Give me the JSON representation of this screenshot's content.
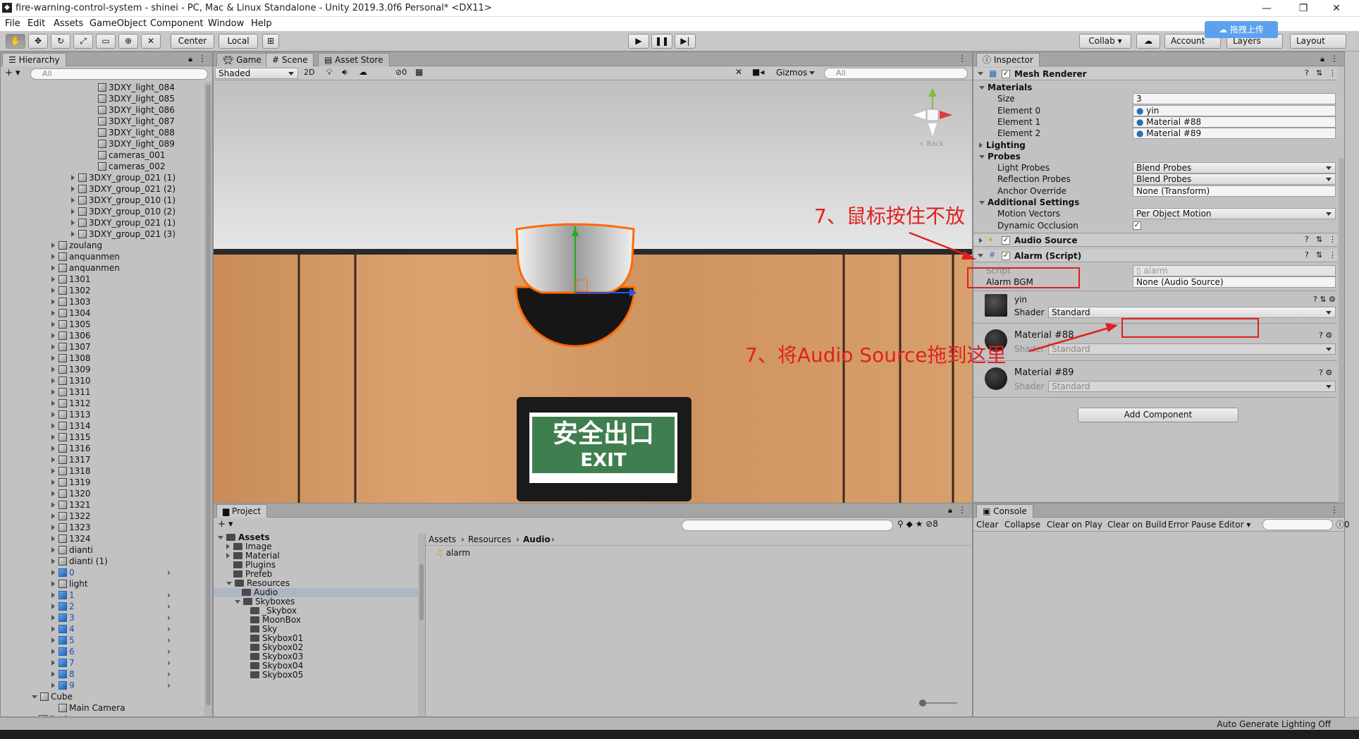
{
  "window": {
    "title": "fire-warning-control-system - shinei - PC, Mac & Linux Standalone - Unity 2019.3.0f6 Personal* <DX11>",
    "min": "—",
    "max": "❐",
    "close": "✕"
  },
  "menu": [
    "File",
    "Edit",
    "Assets",
    "GameObject",
    "Component",
    "Window",
    "Help"
  ],
  "toolbar": {
    "center": "Center",
    "local": "Local",
    "collab": "Collab ▾",
    "account": "Account",
    "layers": "Layers",
    "layout": "Layout",
    "upload": "拖拽上传"
  },
  "hierarchy": {
    "tab": "Hierarchy",
    "search_placeholder": "All",
    "items": [
      {
        "label": "3DXY_light_084",
        "indent": 3,
        "arrow": "none",
        "blue": false
      },
      {
        "label": "3DXY_light_085",
        "indent": 3,
        "arrow": "none",
        "blue": false
      },
      {
        "label": "3DXY_light_086",
        "indent": 3,
        "arrow": "none",
        "blue": false
      },
      {
        "label": "3DXY_light_087",
        "indent": 3,
        "arrow": "none",
        "blue": false
      },
      {
        "label": "3DXY_light_088",
        "indent": 3,
        "arrow": "none",
        "blue": false
      },
      {
        "label": "3DXY_light_089",
        "indent": 3,
        "arrow": "none",
        "blue": false
      },
      {
        "label": "cameras_001",
        "indent": 3,
        "arrow": "none",
        "blue": false
      },
      {
        "label": "cameras_002",
        "indent": 3,
        "arrow": "none",
        "blue": false
      },
      {
        "label": "3DXY_group_021 (1)",
        "indent": 2,
        "arrow": "right",
        "blue": false
      },
      {
        "label": "3DXY_group_021 (2)",
        "indent": 2,
        "arrow": "right",
        "blue": false
      },
      {
        "label": "3DXY_group_010 (1)",
        "indent": 2,
        "arrow": "right",
        "blue": false
      },
      {
        "label": "3DXY_group_010 (2)",
        "indent": 2,
        "arrow": "right",
        "blue": false
      },
      {
        "label": "3DXY_group_021 (1)",
        "indent": 2,
        "arrow": "right",
        "blue": false
      },
      {
        "label": "3DXY_group_021 (3)",
        "indent": 2,
        "arrow": "right",
        "blue": false
      },
      {
        "label": "zoulang",
        "indent": 1,
        "arrow": "right",
        "blue": false
      },
      {
        "label": "anquanmen",
        "indent": 1,
        "arrow": "right",
        "blue": false
      },
      {
        "label": "anquanmen",
        "indent": 1,
        "arrow": "right",
        "blue": false
      },
      {
        "label": "1301",
        "indent": 1,
        "arrow": "right",
        "blue": false
      },
      {
        "label": "1302",
        "indent": 1,
        "arrow": "right",
        "blue": false
      },
      {
        "label": "1303",
        "indent": 1,
        "arrow": "right",
        "blue": false
      },
      {
        "label": "1304",
        "indent": 1,
        "arrow": "right",
        "blue": false
      },
      {
        "label": "1305",
        "indent": 1,
        "arrow": "right",
        "blue": false
      },
      {
        "label": "1306",
        "indent": 1,
        "arrow": "right",
        "blue": false
      },
      {
        "label": "1307",
        "indent": 1,
        "arrow": "right",
        "blue": false
      },
      {
        "label": "1308",
        "indent": 1,
        "arrow": "right",
        "blue": false
      },
      {
        "label": "1309",
        "indent": 1,
        "arrow": "right",
        "blue": false
      },
      {
        "label": "1310",
        "indent": 1,
        "arrow": "right",
        "blue": false
      },
      {
        "label": "1311",
        "indent": 1,
        "arrow": "right",
        "blue": false
      },
      {
        "label": "1312",
        "indent": 1,
        "arrow": "right",
        "blue": false
      },
      {
        "label": "1313",
        "indent": 1,
        "arrow": "right",
        "blue": false
      },
      {
        "label": "1314",
        "indent": 1,
        "arrow": "right",
        "blue": false
      },
      {
        "label": "1315",
        "indent": 1,
        "arrow": "right",
        "blue": false
      },
      {
        "label": "1316",
        "indent": 1,
        "arrow": "right",
        "blue": false
      },
      {
        "label": "1317",
        "indent": 1,
        "arrow": "right",
        "blue": false
      },
      {
        "label": "1318",
        "indent": 1,
        "arrow": "right",
        "blue": false
      },
      {
        "label": "1319",
        "indent": 1,
        "arrow": "right",
        "blue": false
      },
      {
        "label": "1320",
        "indent": 1,
        "arrow": "right",
        "blue": false
      },
      {
        "label": "1321",
        "indent": 1,
        "arrow": "right",
        "blue": false
      },
      {
        "label": "1322",
        "indent": 1,
        "arrow": "right",
        "blue": false
      },
      {
        "label": "1323",
        "indent": 1,
        "arrow": "right",
        "blue": false
      },
      {
        "label": "1324",
        "indent": 1,
        "arrow": "right",
        "blue": false
      },
      {
        "label": "dianti",
        "indent": 1,
        "arrow": "right",
        "blue": false
      },
      {
        "label": "dianti (1)",
        "indent": 1,
        "arrow": "right",
        "blue": false
      },
      {
        "label": "0",
        "indent": 1,
        "arrow": "right",
        "blue": true
      },
      {
        "label": "light",
        "indent": 1,
        "arrow": "right",
        "blue": false
      },
      {
        "label": "1",
        "indent": 1,
        "arrow": "right",
        "blue": true
      },
      {
        "label": "2",
        "indent": 1,
        "arrow": "right",
        "blue": true
      },
      {
        "label": "3",
        "indent": 1,
        "arrow": "right",
        "blue": true
      },
      {
        "label": "4",
        "indent": 1,
        "arrow": "right",
        "blue": true
      },
      {
        "label": "5",
        "indent": 1,
        "arrow": "right",
        "blue": true
      },
      {
        "label": "6",
        "indent": 1,
        "arrow": "right",
        "blue": true
      },
      {
        "label": "7",
        "indent": 1,
        "arrow": "right",
        "blue": true
      },
      {
        "label": "8",
        "indent": 1,
        "arrow": "right",
        "blue": true
      },
      {
        "label": "9",
        "indent": 1,
        "arrow": "right",
        "blue": true
      },
      {
        "label": "Cube",
        "indent": 0,
        "arrow": "down",
        "blue": false
      },
      {
        "label": "Main Camera",
        "indent": 1,
        "arrow": "none",
        "blue": false
      },
      {
        "label": "jiankong",
        "indent": 0,
        "arrow": "none",
        "blue": false
      }
    ]
  },
  "scene": {
    "tabs": [
      "Game",
      "Scene",
      "Asset Store"
    ],
    "shading": "Shaded",
    "mode2d": "2D",
    "fx_count": "0",
    "gizmos": "Gizmos",
    "search_placeholder": "All",
    "back_label": "< Back",
    "exit_sign_cn": "安全出口",
    "exit_sign_en": "EXIT"
  },
  "inspector": {
    "tab": "Inspector",
    "mesh_renderer": "Mesh Renderer",
    "materials": "Materials",
    "size_label": "Size",
    "size_value": "3",
    "elements": [
      {
        "label": "Element 0",
        "value": "yin"
      },
      {
        "label": "Element 1",
        "value": "Material #88"
      },
      {
        "label": "Element 2",
        "value": "Material #89"
      }
    ],
    "lighting": "Lighting",
    "probes": "Probes",
    "light_probes_label": "Light Probes",
    "light_probes_value": "Blend Probes",
    "reflection_probes_label": "Reflection Probes",
    "reflection_probes_value": "Blend Probes",
    "anchor_override_label": "Anchor Override",
    "anchor_override_value": "None (Transform)",
    "additional_settings": "Additional Settings",
    "motion_vectors_label": "Motion Vectors",
    "motion_vectors_value": "Per Object Motion",
    "dynamic_occlusion_label": "Dynamic Occlusion",
    "audio_source": "Audio Source",
    "alarm_script": "Alarm (Script)",
    "script_label": "Script",
    "script_value": "alarm",
    "alarm_bgm_label": "Alarm BGM",
    "alarm_bgm_value": "None (Audio Source)",
    "mat_yin": "yin",
    "shader_label": "Shader",
    "shader_value": "Standard",
    "mat_88": "Material #88",
    "mat_89": "Material #89",
    "add_component": "Add Component"
  },
  "annotations": {
    "a1": "7、鼠标按住不放",
    "a2": "7、将Audio Source拖到这里"
  },
  "project": {
    "tab": "Project",
    "favorites_count": "8",
    "tree": [
      {
        "label": "Assets",
        "indent": 0,
        "arrow": "down",
        "bold": true
      },
      {
        "label": "Image",
        "indent": 1,
        "arrow": "right",
        "bold": false
      },
      {
        "label": "Material",
        "indent": 1,
        "arrow": "right",
        "bold": false
      },
      {
        "label": "Plugins",
        "indent": 1,
        "arrow": "none",
        "bold": false
      },
      {
        "label": "Prefeb",
        "indent": 1,
        "arrow": "none",
        "bold": false
      },
      {
        "label": "Resources",
        "indent": 1,
        "arrow": "down",
        "bold": false
      },
      {
        "label": "Audio",
        "indent": 2,
        "arrow": "none",
        "bold": false,
        "selected": true
      },
      {
        "label": "Skyboxes",
        "indent": 2,
        "arrow": "down",
        "bold": false
      },
      {
        "label": "_Skybox",
        "indent": 3,
        "arrow": "none",
        "bold": false
      },
      {
        "label": "MoonBox",
        "indent": 3,
        "arrow": "none",
        "bold": false
      },
      {
        "label": "Sky",
        "indent": 3,
        "arrow": "none",
        "bold": false
      },
      {
        "label": "Skybox01",
        "indent": 3,
        "arrow": "none",
        "bold": false
      },
      {
        "label": "Skybox02",
        "indent": 3,
        "arrow": "none",
        "bold": false
      },
      {
        "label": "Skybox03",
        "indent": 3,
        "arrow": "none",
        "bold": false
      },
      {
        "label": "Skybox04",
        "indent": 3,
        "arrow": "none",
        "bold": false
      },
      {
        "label": "Skybox05",
        "indent": 3,
        "arrow": "none",
        "bold": false
      }
    ],
    "breadcrumb": [
      "Assets",
      "Resources",
      "Audio"
    ],
    "files": [
      "alarm"
    ]
  },
  "console": {
    "tab": "Console",
    "buttons": [
      "Clear",
      "Collapse",
      "Clear on Play",
      "Clear on Build",
      "Error Pause",
      "Editor ▾"
    ],
    "count": "0"
  },
  "status": {
    "text": "Auto Generate Lighting Off"
  }
}
